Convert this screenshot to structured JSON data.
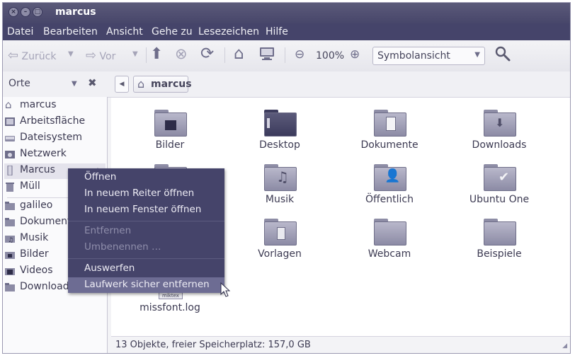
{
  "window": {
    "title": "marcus"
  },
  "menubar": [
    "Datei",
    "Bearbeiten",
    "Ansicht",
    "Gehe zu",
    "Lesezeichen",
    "Hilfe"
  ],
  "toolbar": {
    "back_label": "Zurück",
    "forward_label": "Vor",
    "zoom": "100%",
    "view_mode": "Symbolansicht"
  },
  "locationbar": {
    "places_label": "Orte",
    "crumb": "marcus"
  },
  "sidebar": {
    "items": [
      {
        "label": "marcus",
        "icon": "home-icon"
      },
      {
        "label": "Arbeitsfläche",
        "icon": "desktop-icon"
      },
      {
        "label": "Dateisystem",
        "icon": "harddisk-icon"
      },
      {
        "label": "Netzwerk",
        "icon": "network-icon"
      },
      {
        "label": "Marcus",
        "icon": "usb-drive-icon"
      },
      {
        "label": "Müll",
        "icon": "trash-icon"
      }
    ],
    "bookmarks": [
      {
        "label": "galileo",
        "icon": "folder-icon"
      },
      {
        "label": "Dokumente",
        "icon": "folder-icon"
      },
      {
        "label": "Musik",
        "icon": "music-folder-icon"
      },
      {
        "label": "Bilder",
        "icon": "pictures-folder-icon"
      },
      {
        "label": "Videos",
        "icon": "video-folder-icon"
      },
      {
        "label": "Downloads",
        "icon": "folder-icon"
      }
    ]
  },
  "files": [
    {
      "label": "Bilder",
      "icon": "pictures-folder-icon"
    },
    {
      "label": "Desktop",
      "icon": "desktop-folder-icon"
    },
    {
      "label": "Dokumente",
      "icon": "documents-folder-icon"
    },
    {
      "label": "Downloads",
      "icon": "downloads-folder-icon"
    },
    {
      "label": "Musik",
      "icon": "music-folder-icon"
    },
    {
      "label": "Öffentlich",
      "icon": "public-folder-icon"
    },
    {
      "label": "Ubuntu One",
      "icon": "ubuntu-one-folder-icon"
    },
    {
      "label": "Vorlagen",
      "icon": "templates-folder-icon"
    },
    {
      "label": "Webcam",
      "icon": "folder-icon"
    },
    {
      "label": "Beispiele",
      "icon": "folder-icon"
    },
    {
      "label": "missfont.log",
      "icon": "text-file-icon"
    }
  ],
  "status": "13 Objekte, freier Speicherplatz: 157,0 GB",
  "context_menu": [
    {
      "label": "Öffnen",
      "enabled": true
    },
    {
      "label": "In neuem Reiter öffnen",
      "enabled": true
    },
    {
      "label": "In neuem Fenster öffnen",
      "enabled": true
    },
    {
      "label": "Entfernen",
      "enabled": false
    },
    {
      "label": "Umbenennen …",
      "enabled": false
    },
    {
      "label": "Auswerfen",
      "enabled": true
    },
    {
      "label": "Laufwerk sicher entfernen",
      "enabled": true,
      "highlighted": true
    }
  ],
  "file_thumb_text": "miktex"
}
